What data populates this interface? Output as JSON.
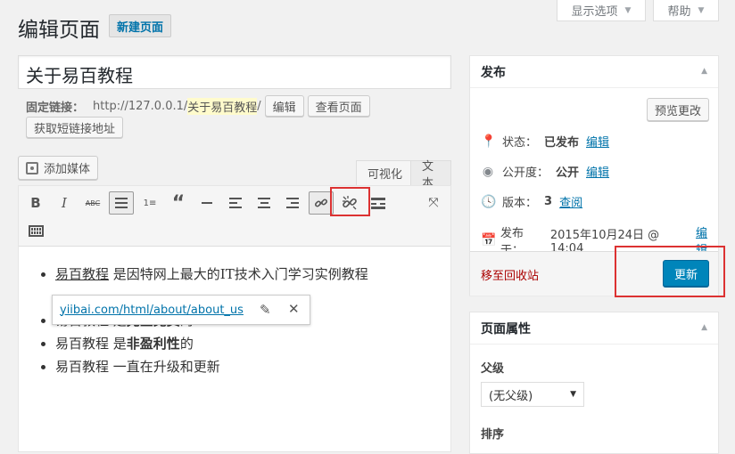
{
  "screen_options": {
    "label": "显示选项"
  },
  "help": {
    "label": "帮助"
  },
  "header": {
    "title": "编辑页面",
    "add_new": "新建页面"
  },
  "post_title": {
    "value": "关于易百教程"
  },
  "permalink": {
    "label": "固定链接：",
    "url_prefix": "http://127.0.0.1/",
    "slug": "关于易百教程",
    "url_suffix": "/",
    "edit_label": "编辑",
    "view_label": "查看页面",
    "shortlink_label": "获取短链接地址"
  },
  "editor": {
    "add_media": "添加媒体",
    "tab_visual": "可视化",
    "tab_text": "文本",
    "list_items": [
      {
        "a": "易百教程",
        "b": " 是因特网上最大的IT技术入门学习实例教程"
      },
      {
        "a": "易百教程",
        "b": " 是",
        "bold": "完全免费",
        "c": "的"
      },
      {
        "a": "易百教程",
        "b": " 是",
        "bold": "非盈利性",
        "c": "的"
      },
      {
        "a": "易百教程",
        "b": " 一直在升级和更新"
      }
    ],
    "link_popup_url": "yiibai.com/html/about/about_us"
  },
  "publish": {
    "title": "发布",
    "preview_label": "预览更改",
    "status_label": "状态：",
    "status_value": "已发布",
    "status_edit": "编辑",
    "visibility_label": "公开度：",
    "visibility_value": "公开",
    "visibility_edit": "编辑",
    "revisions_label": "版本：",
    "revisions_value": "3",
    "revisions_link": "查阅",
    "published_label": "发布于：",
    "published_value": "2015年10月24日 @ 14:04",
    "published_edit": "编辑",
    "trash_label": "移至回收站",
    "update_label": "更新"
  },
  "page_attributes": {
    "title": "页面属性",
    "parent_label": "父级",
    "parent_value": "(无父级)",
    "order_label": "排序"
  },
  "colors": {
    "primary": "#0085ba",
    "link": "#0073aa",
    "highlight_box": "#dc3232",
    "trash": "#a00"
  }
}
